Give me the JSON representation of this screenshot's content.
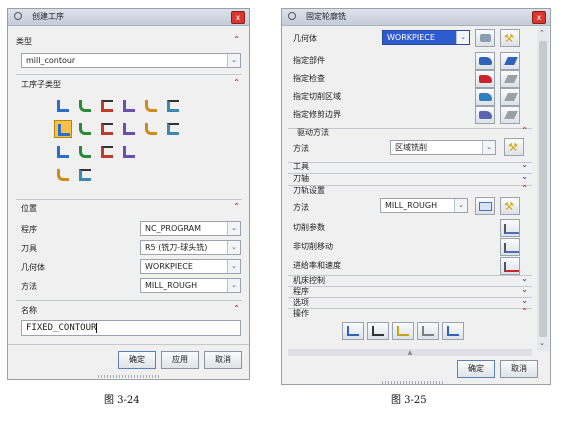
{
  "captions": {
    "left": "图 3-24",
    "right": "图 3-25"
  },
  "create_op": {
    "title": "创建工序",
    "close_label": "x",
    "type_section": "类型",
    "type_value": "mill_contour",
    "subtype_section": "工序子类型",
    "subtype_icons": [
      "zlevel-profile-icon",
      "zlevel-corner-icon",
      "contour-area-icon",
      "contour-area-non-steep-icon",
      "contour-area-dir-steep-icon",
      "flowcut-single-icon",
      "flowcut-multi-icon",
      "fixed-contour-icon",
      "flowcut-ref-tool-icon",
      "solid-profile-3d-icon",
      "streamline-icon",
      "zlevel-profile-steep-icon",
      "profile-3d-icon",
      "flowcut-smooth-icon",
      "rough-contour-icon",
      "contour-text-icon",
      "generic-motion-icon",
      "mill-user-icon"
    ],
    "location_section": "位置",
    "rows": [
      {
        "label": "程序",
        "value": "NC_PROGRAM"
      },
      {
        "label": "刀具",
        "value": "R5 (铣刀-球头铣)"
      },
      {
        "label": "几何体",
        "value": "WORKPIECE"
      },
      {
        "label": "方法",
        "value": "MILL_ROUGH"
      }
    ],
    "name_section": "名称",
    "name_value": "FIXED_CONTOUR",
    "ok": "确定",
    "apply": "应用",
    "cancel": "取消"
  },
  "fixed_contour": {
    "title": "固定轮廓铣",
    "close_label": "x",
    "geometry_label": "几何体",
    "geometry_value": "WORKPIECE",
    "geom_rows": [
      "指定部件",
      "指定检查",
      "指定切削区域",
      "指定修剪边界"
    ],
    "drive_section": "驱动方法",
    "drive_method_label": "方法",
    "drive_method_value": "区域铣削",
    "tool_section": "工具",
    "axis_section": "刀轴",
    "path_section": "刀轨设置",
    "path_method_label": "方法",
    "path_method_value": "MILL_ROUGH",
    "path_rows": [
      "切削参数",
      "非切削移动",
      "进给率和速度"
    ],
    "machine_section": "机床控制",
    "program_section": "程序",
    "options_section": "选项",
    "actions_section": "操作",
    "action_icons": [
      "generate-icon",
      "replay-icon",
      "verify-icon",
      "list-icon",
      "postprocess-icon"
    ],
    "ok": "确定",
    "cancel": "取消"
  },
  "colors": {
    "close": "#d9382f",
    "expand_chevron": "#c22222",
    "collapse_chevron": "#3a4fa8",
    "selected_icon": "#f6c24a"
  }
}
